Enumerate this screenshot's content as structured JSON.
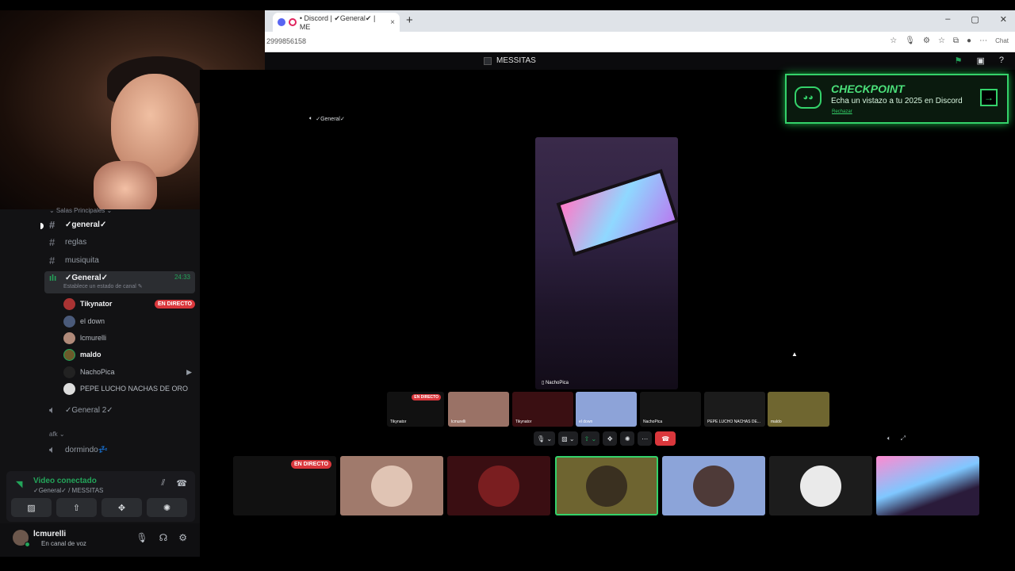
{
  "browser": {
    "tab_title": "• Discord | ✔General✔ | ME",
    "tab_close": "×",
    "new_tab": "+",
    "address": "2999856158",
    "chat_label": "Chat",
    "window_controls": [
      "–",
      "▢",
      "✕"
    ]
  },
  "discord": {
    "server_name": "MESSITAS",
    "category_main": "⌄ Salas Principales ⌄",
    "channels": [
      {
        "name": "✓general✓",
        "icon": "hash-icon"
      },
      {
        "name": "reglas",
        "icon": "hash-icon"
      },
      {
        "name": "musiquita",
        "icon": "hash-icon"
      }
    ],
    "voice_channel": {
      "name": "✓General✓",
      "time": "24:33",
      "status_hint": "Establece un estado de canal ✎"
    },
    "members": [
      {
        "name": "Tikynator",
        "live": "EN DIRECTO",
        "bold": true
      },
      {
        "name": "el down"
      },
      {
        "name": "lcmurelli"
      },
      {
        "name": "maldo",
        "bold": true
      },
      {
        "name": "NachoPica",
        "cam": "▶"
      },
      {
        "name": "PEPE LUCHO NACHAS DE ORO"
      }
    ],
    "voice_channel_2": "✓General 2✓",
    "category_afk": "afk ⌄",
    "afk_channel": "dormindo💤",
    "voice_panel": {
      "title": "Video conectado",
      "subtitle": "✓General✓ / MESSITAS"
    },
    "user": {
      "name": "lcmurelli",
      "status": "En canal de voz"
    }
  },
  "call": {
    "label": "✓General✓",
    "main_video_label": "▯ NachoPica",
    "strip_labels": [
      "Tikynator",
      "lcmurelli",
      "Tikynator",
      "el down",
      "NachoPica",
      "PEPE LUCHO NACHAS DE...",
      "maldo"
    ],
    "live_badge": "EN DIRECTO"
  },
  "checkpoint": {
    "title": "CHECKPOINT",
    "subtitle": "Echa un vistazo a tu 2025 en Discord",
    "dismiss": "Rechazar",
    "arrow": "→"
  },
  "colors": {
    "accent_green": "#23a55a",
    "live_red": "#da373c",
    "checkpoint_green": "#34d26a"
  }
}
